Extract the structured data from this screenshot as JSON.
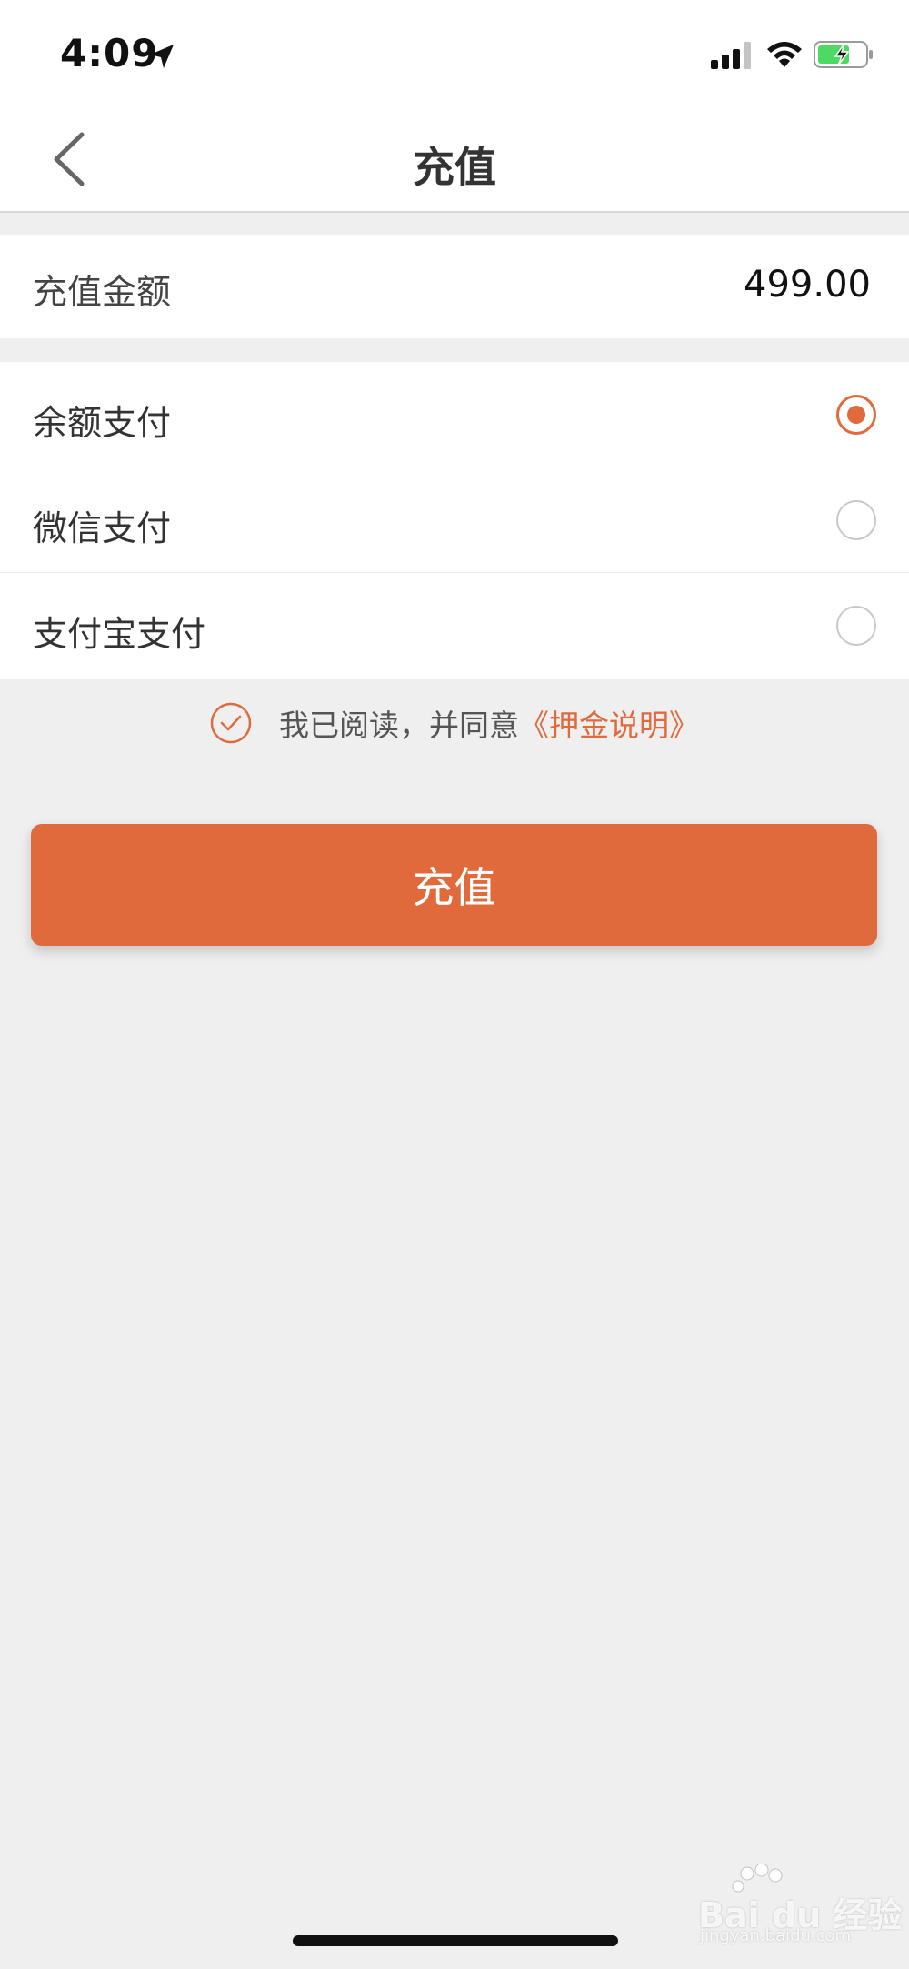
{
  "status_bar": {
    "time": "4:09",
    "icons": [
      "location-arrow-icon",
      "signal-icon",
      "wifi-icon",
      "battery-charging-icon"
    ]
  },
  "nav": {
    "back_icon": "chevron-left-icon",
    "title": "充值"
  },
  "amount": {
    "label": "充值金额",
    "value": "499.00"
  },
  "payment_methods": [
    {
      "label": "余额支付",
      "selected": true
    },
    {
      "label": "微信支付",
      "selected": false
    },
    {
      "label": "支付宝支付",
      "selected": false
    }
  ],
  "agreement": {
    "checked": true,
    "text": "我已阅读，并同意",
    "link": "《押金说明》"
  },
  "submit_button": {
    "label": "充值"
  },
  "watermark": {
    "brand": "Bai du 经验",
    "url": "jingyan.baidu.com"
  },
  "colors": {
    "accent": "#e06a3c",
    "background": "#efefef",
    "surface": "#ffffff"
  }
}
